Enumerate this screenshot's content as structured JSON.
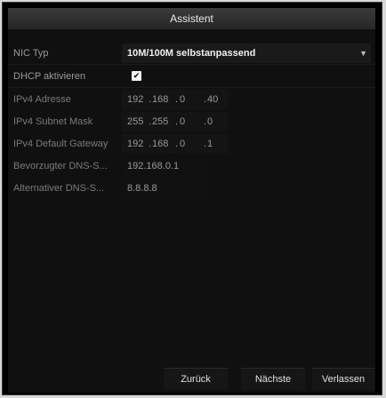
{
  "dialog": {
    "title": "Assistent"
  },
  "nic": {
    "label": "NIC Typ",
    "value": "10M/100M selbstanpassend"
  },
  "dhcp": {
    "label": "DHCP aktivieren",
    "checked": true
  },
  "ipv4_address": {
    "label": "IPv4 Adresse",
    "octets": [
      "192",
      "168",
      "0",
      "40"
    ]
  },
  "ipv4_subnet": {
    "label": "IPv4 Subnet Mask",
    "octets": [
      "255",
      "255",
      "0",
      "0"
    ]
  },
  "ipv4_gateway": {
    "label": "IPv4 Default Gateway",
    "octets": [
      "192",
      "168",
      "0",
      "1"
    ]
  },
  "dns_preferred": {
    "label": "Bevorzugter DNS-S...",
    "value": "192.168.0.1"
  },
  "dns_alternate": {
    "label": "Alternativer DNS-S...",
    "value": "8.8.8.8"
  },
  "buttons": {
    "back": "Zurück",
    "next": "Nächste",
    "exit": "Verlassen"
  }
}
